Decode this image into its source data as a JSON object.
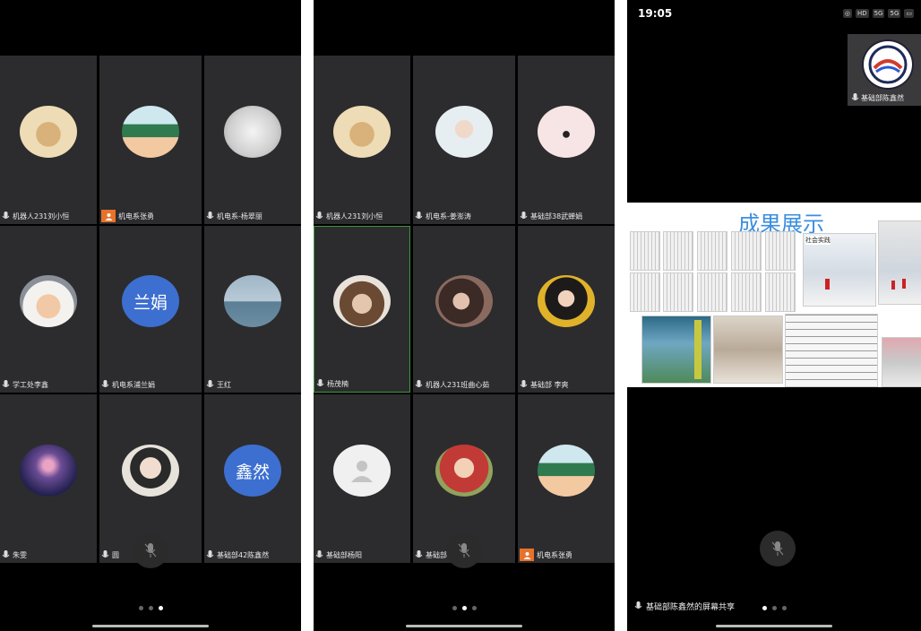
{
  "panel1": {
    "tiles": [
      {
        "name": "机器人231刘小恒",
        "avatar": "cartoon-star",
        "host": false
      },
      {
        "name": "机电系张勇",
        "avatar": "classroom-cartoon",
        "host": true
      },
      {
        "name": "机电系-杨翠丽",
        "avatar": "sketch",
        "host": false
      },
      {
        "name": "学工处李鑫",
        "avatar": "child-hat",
        "host": false
      },
      {
        "name": "机电系浦兰娟",
        "avatar": "text",
        "avatar_text": "兰娟",
        "avatar_color": "#3d6fd1",
        "host": false
      },
      {
        "name": "王红",
        "avatar": "sea",
        "host": false
      },
      {
        "name": "朱雯",
        "avatar": "night-sky",
        "host": false
      },
      {
        "name": "圆",
        "avatar": "anime-boy",
        "host": false
      },
      {
        "name": "基础部42陈鑫然",
        "avatar": "text",
        "avatar_text": "鑫然",
        "avatar_color": "#3d6fd1",
        "host": false
      }
    ],
    "page_dots": 3,
    "active_dot": 2
  },
  "panel2": {
    "tiles": [
      {
        "name": "机器人231刘小恒",
        "avatar": "cartoon-star",
        "host": false
      },
      {
        "name": "机电系-姜澎涛",
        "avatar": "child-white",
        "host": false
      },
      {
        "name": "基础部38武蝉娟",
        "avatar": "dancer",
        "host": false
      },
      {
        "name": "杨茂楠",
        "avatar": "child-fur",
        "host": false,
        "active": true
      },
      {
        "name": "机器人231班曲心茹",
        "avatar": "girl-dark",
        "host": false
      },
      {
        "name": "基础部 李爽",
        "avatar": "girl-yellow",
        "host": false
      },
      {
        "name": "基础部杨阳",
        "avatar": "default-person",
        "host": false
      },
      {
        "name": "基础部",
        "avatar": "baby-red",
        "host": false
      },
      {
        "name": "机电系张勇",
        "avatar": "classroom-cartoon",
        "host": true
      }
    ],
    "page_dots": 3,
    "active_dot": 1
  },
  "panel3": {
    "status_time": "19:05",
    "status_icons": [
      "wifi",
      "HD",
      "5G",
      "5G",
      "battery"
    ],
    "pip_label": "基础部陈鑫然",
    "share_title": "成果展示",
    "share_tag": "社会实践",
    "bottom_label": "基础部陈鑫然的屏幕共享",
    "page_dots": 3,
    "active_dot": 0
  },
  "colors": {
    "tile_bg": "#2c2c2e",
    "avatar_blue": "#3d6fd1",
    "host_orange": "#e8722a",
    "share_title_blue": "#3b8ee0"
  }
}
